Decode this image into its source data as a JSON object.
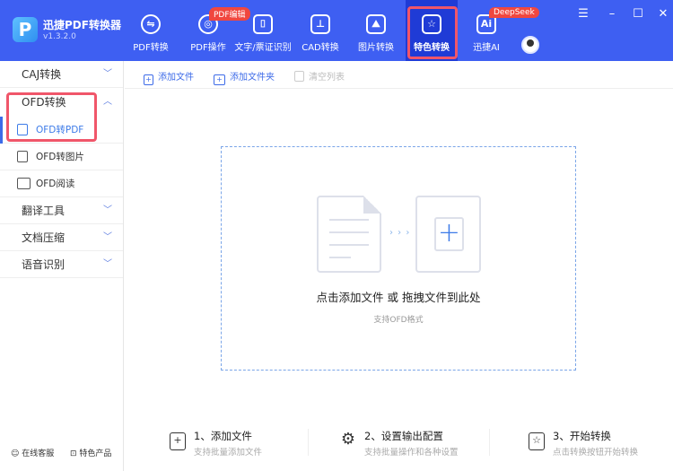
{
  "app": {
    "logo": "P",
    "name": "迅捷PDF转换器",
    "version": "v1.3.2.0"
  },
  "nav": [
    {
      "label": "PDF转换",
      "icon": "convert-icon",
      "glyph": "⇋"
    },
    {
      "label": "PDF操作",
      "icon": "disc-icon",
      "glyph": "◎",
      "badge": "PDF编辑"
    },
    {
      "label": "文字/票证识别",
      "icon": "scan-icon",
      "glyph": "⌷"
    },
    {
      "label": "CAD转换",
      "icon": "cad-icon",
      "glyph": "⊥"
    },
    {
      "label": "图片转换",
      "icon": "image-icon",
      "glyph": "⛰"
    },
    {
      "label": "特色转换",
      "icon": "star-convert-icon",
      "glyph": "☆",
      "active": true
    },
    {
      "label": "迅捷AI",
      "icon": "ai-icon",
      "glyph": "Ai",
      "badge": "DeepSeek"
    }
  ],
  "window": {
    "menu": "☰",
    "minimize": "–",
    "maximize": "☐",
    "close": "✕"
  },
  "sidebar": {
    "groups": [
      {
        "label": "CAJ转换",
        "chevron": "﹀"
      },
      {
        "label": "OFD转换",
        "chevron": "︿",
        "expanded": true
      },
      {
        "label": "翻译工具",
        "chevron": "﹀"
      },
      {
        "label": "文档压缩",
        "chevron": "﹀"
      },
      {
        "label": "语音识别",
        "chevron": "﹀"
      }
    ],
    "ofd_items": [
      {
        "label": "OFD转PDF",
        "icon": "pdf-file-icon",
        "selected": true
      },
      {
        "label": "OFD转图片",
        "icon": "image-icon"
      },
      {
        "label": "OFD阅读",
        "icon": "book-icon"
      }
    ],
    "footer": {
      "support": "在线客服",
      "products": "特色产品"
    }
  },
  "toolbar": {
    "add_file": "添加文件",
    "add_folder": "添加文件夹",
    "clear_list": "清空列表"
  },
  "dropzone": {
    "arrows": "› › ›",
    "plus": "+",
    "title": "点击添加文件 或 拖拽文件到此处",
    "subtitle": "支持OFD格式"
  },
  "steps": [
    {
      "title": "1、添加文件",
      "desc": "支持批量添加文件",
      "glyph": "+"
    },
    {
      "title": "2、设置输出配置",
      "desc": "支持批量操作和各种设置",
      "glyph": "⚙"
    },
    {
      "title": "3、开始转换",
      "desc": "点击转换按钮开始转换",
      "glyph": "☆"
    }
  ],
  "colors": {
    "header": "#3e5ff2",
    "accent": "#3d6be8",
    "highlight": "#f0566a",
    "badge": "#f0473f"
  }
}
